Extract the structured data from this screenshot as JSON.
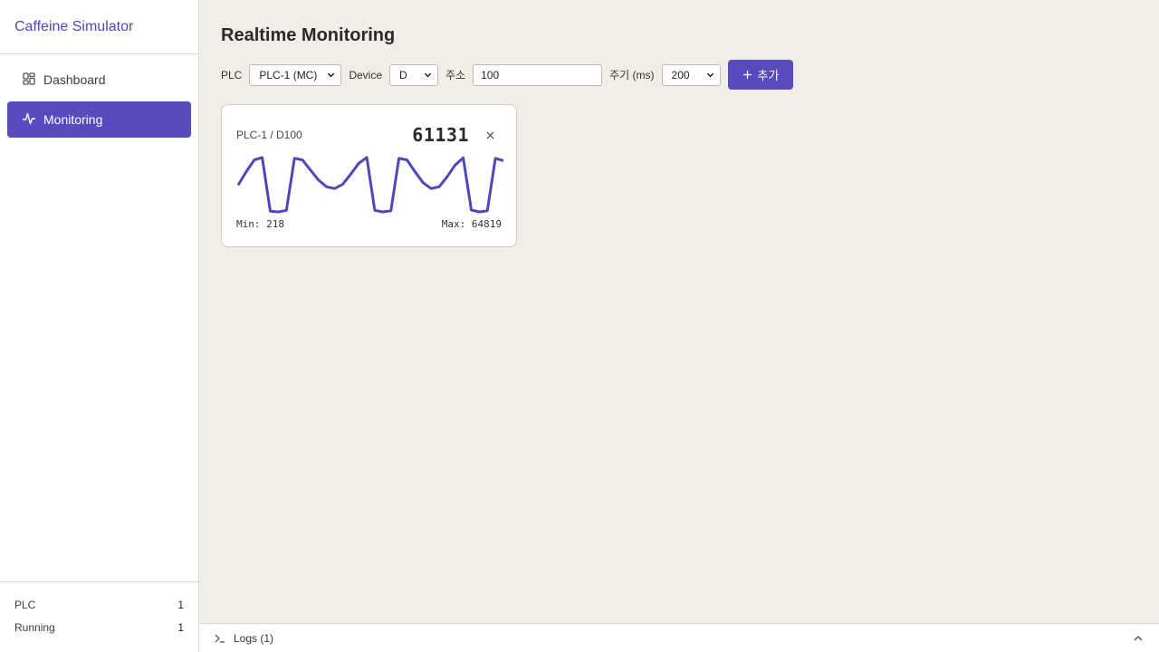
{
  "app": {
    "title": "Caffeine Simulator"
  },
  "sidebar": {
    "items": [
      {
        "label": "Dashboard",
        "icon": "dashboard-icon",
        "active": false
      },
      {
        "label": "Monitoring",
        "icon": "activity-icon",
        "active": true
      }
    ],
    "stats": [
      {
        "label": "PLC",
        "value": "1"
      },
      {
        "label": "Running",
        "value": "1"
      }
    ]
  },
  "main": {
    "title": "Realtime Monitoring",
    "toolbar": {
      "plc_label": "PLC",
      "plc_value": "PLC-1 (MC)",
      "device_label": "Device",
      "device_value": "D",
      "address_label": "주소",
      "address_value": "100",
      "interval_label": "주기 (ms)",
      "interval_value": "200",
      "add_label": "추가",
      "add_icon": "plus-icon"
    },
    "monitor_card": {
      "label": "PLC-1 / D100",
      "value": "61131",
      "min_text": "Min: 218",
      "max_text": "Max: 64819",
      "close_icon": "close-icon",
      "line_color": "#4f47b8"
    }
  },
  "chart_data": {
    "type": "line",
    "title": "",
    "xlabel": "",
    "ylabel": "",
    "ylim": [
      218,
      64819
    ],
    "series": [
      {
        "values": [
          32000,
          48000,
          62000,
          64819,
          1000,
          218,
          2000,
          64000,
          62000,
          50000,
          38000,
          30000,
          28000,
          33000,
          45000,
          58000,
          64819,
          2000,
          218,
          1500,
          64000,
          62000,
          48000,
          35000,
          28000,
          30000,
          42000,
          56000,
          64500,
          2500,
          218,
          1500,
          64000,
          61131
        ]
      }
    ]
  },
  "logs": {
    "label": "Logs (1)",
    "icon": "terminal-icon",
    "toggle_icon": "chevron-up-icon"
  },
  "colors": {
    "accent": "#574bbd",
    "brand_text": "#4f47b8",
    "background": "#f1eee8"
  }
}
